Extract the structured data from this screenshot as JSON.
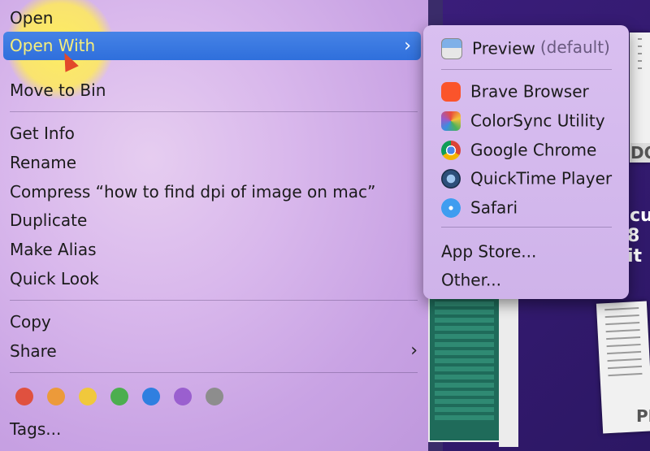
{
  "menu": {
    "items": [
      {
        "label": "Open"
      },
      {
        "label": "Open With",
        "selected": true
      },
      {
        "label": "Move to Bin"
      },
      {
        "label": "Get Info"
      },
      {
        "label": "Rename"
      },
      {
        "label": "Compress “how to find dpi of image on mac”"
      },
      {
        "label": "Duplicate"
      },
      {
        "label": "Make Alias"
      },
      {
        "label": "Quick Look"
      },
      {
        "label": "Copy"
      },
      {
        "label": "Share"
      },
      {
        "label": "Tags..."
      }
    ],
    "tag_colors": [
      "#e0513f",
      "#ec9a3a",
      "#f0c83c",
      "#4cae4f",
      "#2f7fe0",
      "#9a5fcf",
      "#8d8d8d"
    ]
  },
  "submenu": {
    "items": [
      {
        "label": "Preview",
        "suffix": "(default)",
        "icon": "preview-icon"
      },
      {
        "label": "Brave Browser",
        "icon": "brave-icon"
      },
      {
        "label": "ColorSync Utility",
        "icon": "colorsync-icon"
      },
      {
        "label": "Google Chrome",
        "icon": "chrome-icon"
      },
      {
        "label": "QuickTime Player",
        "icon": "quicktime-icon"
      },
      {
        "label": "Safari",
        "icon": "safari-icon"
      },
      {
        "label": "App Store..."
      },
      {
        "label": "Other..."
      }
    ]
  },
  "background": {
    "texts": [
      "cu",
      "8 it",
      "DO",
      "PI"
    ]
  }
}
